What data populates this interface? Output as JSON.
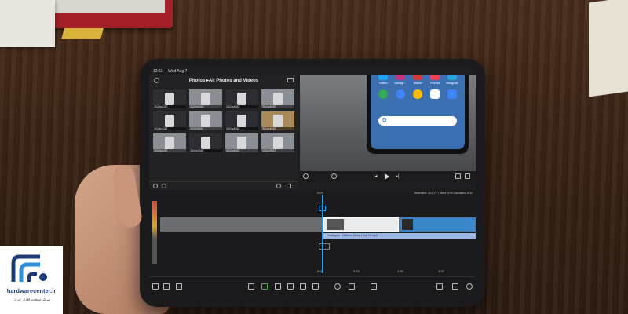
{
  "statusbar": {
    "time": "12:53",
    "date": "Wed Aug 7"
  },
  "media": {
    "title": "Photos ▸All Photos and Videos",
    "thumbs": [
      {
        "res": "3024x4032",
        "tone": "dark"
      },
      {
        "res": "3024x4032",
        "tone": "light"
      },
      {
        "res": "3024x4032",
        "tone": "dark"
      },
      {
        "res": "3024x4032",
        "tone": "light"
      },
      {
        "res": "3024x4032",
        "tone": "dark"
      },
      {
        "res": "4032x3024",
        "tone": "light"
      },
      {
        "res": "3024x4032",
        "tone": "dark"
      },
      {
        "res": "3024x4032",
        "tone": "warm"
      },
      {
        "res": "3024x4032",
        "tone": "light"
      },
      {
        "res": "3840x2160",
        "tone": "dark"
      },
      {
        "res": "3024x4032",
        "tone": "light"
      },
      {
        "res": "4032x3024",
        "tone": "light"
      }
    ]
  },
  "preview": {
    "apps": [
      "Twitter",
      "Instagr...",
      "Tasker",
      "Pocket",
      "Telegram"
    ],
    "search_logo": "G"
  },
  "timeline": {
    "start_time": "0:00",
    "selected_info": "Selected: 2DC77 I Start: 0:00 Duration: 0:11",
    "audio_label": "Paradigms - Outlined (Song Loop M).mp3",
    "ruler": [
      "0:00",
      "0:23",
      "1:20",
      "1:23"
    ]
  },
  "logo": {
    "site": "hardwarecenter.ir",
    "fa": "مرکز سخت افزار ایران"
  },
  "colors": {
    "accent": "#1e9ff2",
    "clip_selected": "#3a86c8",
    "brand": "#1d3b78"
  }
}
